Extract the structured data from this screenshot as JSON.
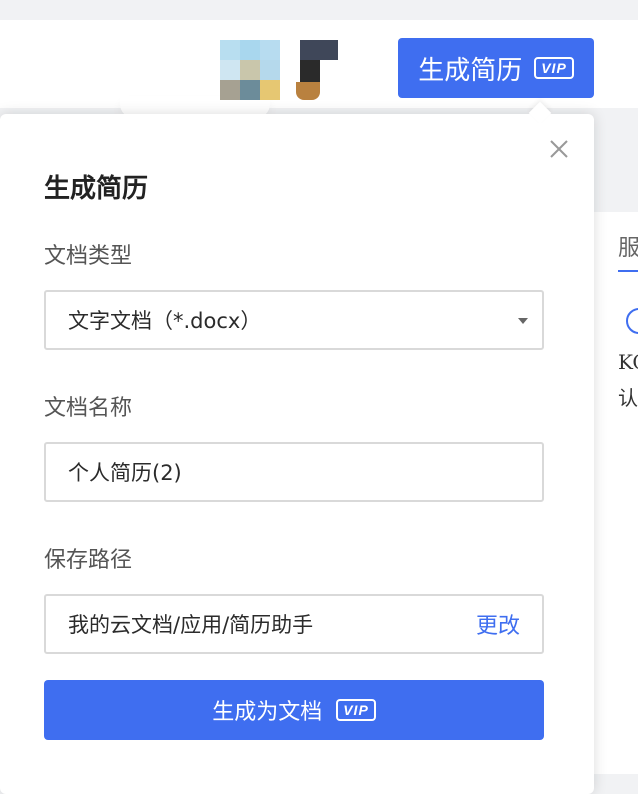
{
  "toolbar": {
    "generate_button_label": "生成简历",
    "vip_badge": "VIP",
    "accent_color": "#3f6ef0"
  },
  "background_panel": {
    "tab_text": "服",
    "line1": "KC",
    "line2": "认"
  },
  "dialog": {
    "title": "生成简历",
    "close_icon": "close-icon",
    "doc_type": {
      "label": "文档类型",
      "selected": "文字文档（*.docx）"
    },
    "doc_name": {
      "label": "文档名称",
      "value": "个人简历(2)"
    },
    "save_path": {
      "label": "保存路径",
      "value": "我的云文档/应用/简历助手",
      "change_link": "更改"
    },
    "submit": {
      "label": "生成为文档",
      "vip_badge": "VIP"
    }
  }
}
